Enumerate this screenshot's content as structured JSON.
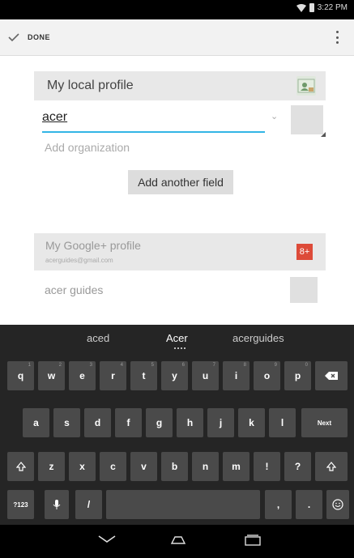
{
  "status_bar": {
    "time": "3:22 PM"
  },
  "action_bar": {
    "done_label": "DONE"
  },
  "local_profile": {
    "title": "My local profile"
  },
  "name_field": {
    "value": "acer"
  },
  "add_organization": "Add organization",
  "add_field_button": "Add another field",
  "google_profile": {
    "title": "My Google+ profile",
    "email": "acerguides@gmail.com",
    "icon_text": "8+"
  },
  "second_account_name": "acer guides",
  "keyboard": {
    "suggestions": [
      "aced",
      "Acer",
      "acerguides"
    ],
    "row1": [
      {
        "label": "q",
        "sub": "1"
      },
      {
        "label": "w",
        "sub": "2"
      },
      {
        "label": "e",
        "sub": "3"
      },
      {
        "label": "r",
        "sub": "4"
      },
      {
        "label": "t",
        "sub": "5"
      },
      {
        "label": "y",
        "sub": "6"
      },
      {
        "label": "u",
        "sub": "7"
      },
      {
        "label": "i",
        "sub": "8"
      },
      {
        "label": "o",
        "sub": "9"
      },
      {
        "label": "p",
        "sub": "0"
      }
    ],
    "row2": [
      "a",
      "s",
      "d",
      "f",
      "g",
      "h",
      "j",
      "k",
      "l"
    ],
    "row3": [
      "z",
      "x",
      "c",
      "v",
      "b",
      "n",
      "m",
      "!",
      "?"
    ],
    "next_label": "Next",
    "symbols_label": "?123",
    "slash_label": "/",
    "comma_label": ",",
    "period_label": "."
  },
  "icons": {
    "done": "check-icon",
    "overflow": "overflow-menu-icon",
    "contact": "contact-card-icon",
    "backspace": "backspace-icon",
    "shift": "shift-icon",
    "mic": "mic-icon",
    "emoji": "emoji-icon"
  },
  "colors": {
    "accent": "#33b5e5",
    "google_red": "#dd4b39"
  }
}
